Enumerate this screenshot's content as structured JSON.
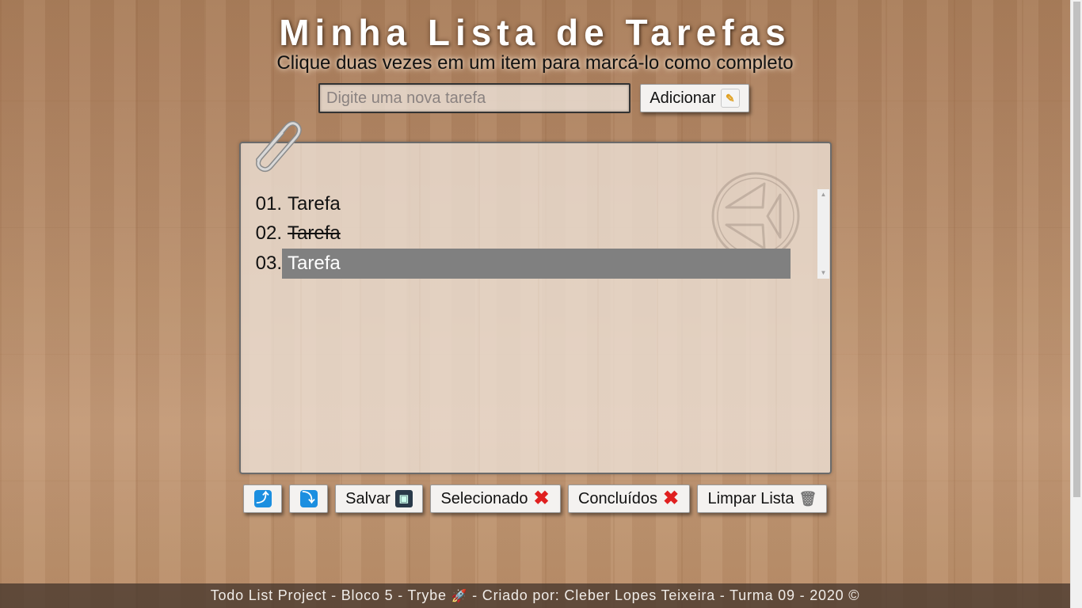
{
  "header": {
    "title": "Minha Lista de Tarefas",
    "subtitle": "Clique duas vezes em um item para marcá-lo como completo"
  },
  "new_task": {
    "placeholder": "Digite uma nova tarefa",
    "value": "",
    "add_label": "Adicionar",
    "add_icon": "memo-icon"
  },
  "tasks": [
    {
      "number": "01.",
      "text": "Tarefa",
      "completed": false,
      "selected": false
    },
    {
      "number": "02.",
      "text": "Tarefa",
      "completed": true,
      "selected": false
    },
    {
      "number": "03.",
      "text": "Tarefa",
      "completed": false,
      "selected": true
    }
  ],
  "toolbar": {
    "move_up_icon": "arrow-up-icon",
    "move_down_icon": "arrow-down-icon",
    "save_label": "Salvar",
    "save_icon": "floppy-disk-icon",
    "remove_selected_label": "Selecionado",
    "remove_selected_icon": "cross-mark-icon",
    "remove_done_label": "Concluídos",
    "remove_done_icon": "cross-mark-icon",
    "clear_label": "Limpar Lista",
    "clear_icon": "wastebasket-icon"
  },
  "footer": {
    "text_before_icon": "Todo List Project - Bloco 5 - Trybe",
    "text_after_icon": "- Criado por: Cleber Lopes Teixeira - Turma 09 - 2020 ©",
    "icon": "rocket-icon"
  },
  "colors": {
    "selected_bg": "#808080",
    "selected_text": "#ffffff",
    "delete_red": "#e02020",
    "arrow_blue": "#1c8fe0"
  }
}
